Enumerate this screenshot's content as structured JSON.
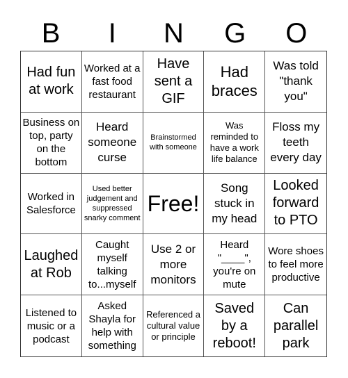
{
  "header": [
    "B",
    "I",
    "N",
    "G",
    "O"
  ],
  "cells": [
    "Had fun at work",
    "Worked at a fast food restaurant",
    "Have sent a GIF",
    "Had braces",
    "Was told \"thank you\"",
    "Business on top, party on the bottom",
    "Heard someone curse",
    "Brainstormed with someone",
    "Was reminded to have a work life balance",
    "Floss my teeth every day",
    "Worked in Salesforce",
    "Used better judgement and suppressed snarky comment",
    "Free!",
    "Song stuck in my head",
    "Looked forward to PTO",
    "Laughed at Rob",
    "Caught myself talking to...myself",
    "Use 2 or more monitors",
    "Heard \"____\", you're on mute",
    "Wore shoes to feel more productive",
    "Listened to music or a podcast",
    "Asked Shayla for help with something",
    "Referenced a cultural value or principle",
    "Saved by a reboot!",
    "Can parallel park"
  ]
}
